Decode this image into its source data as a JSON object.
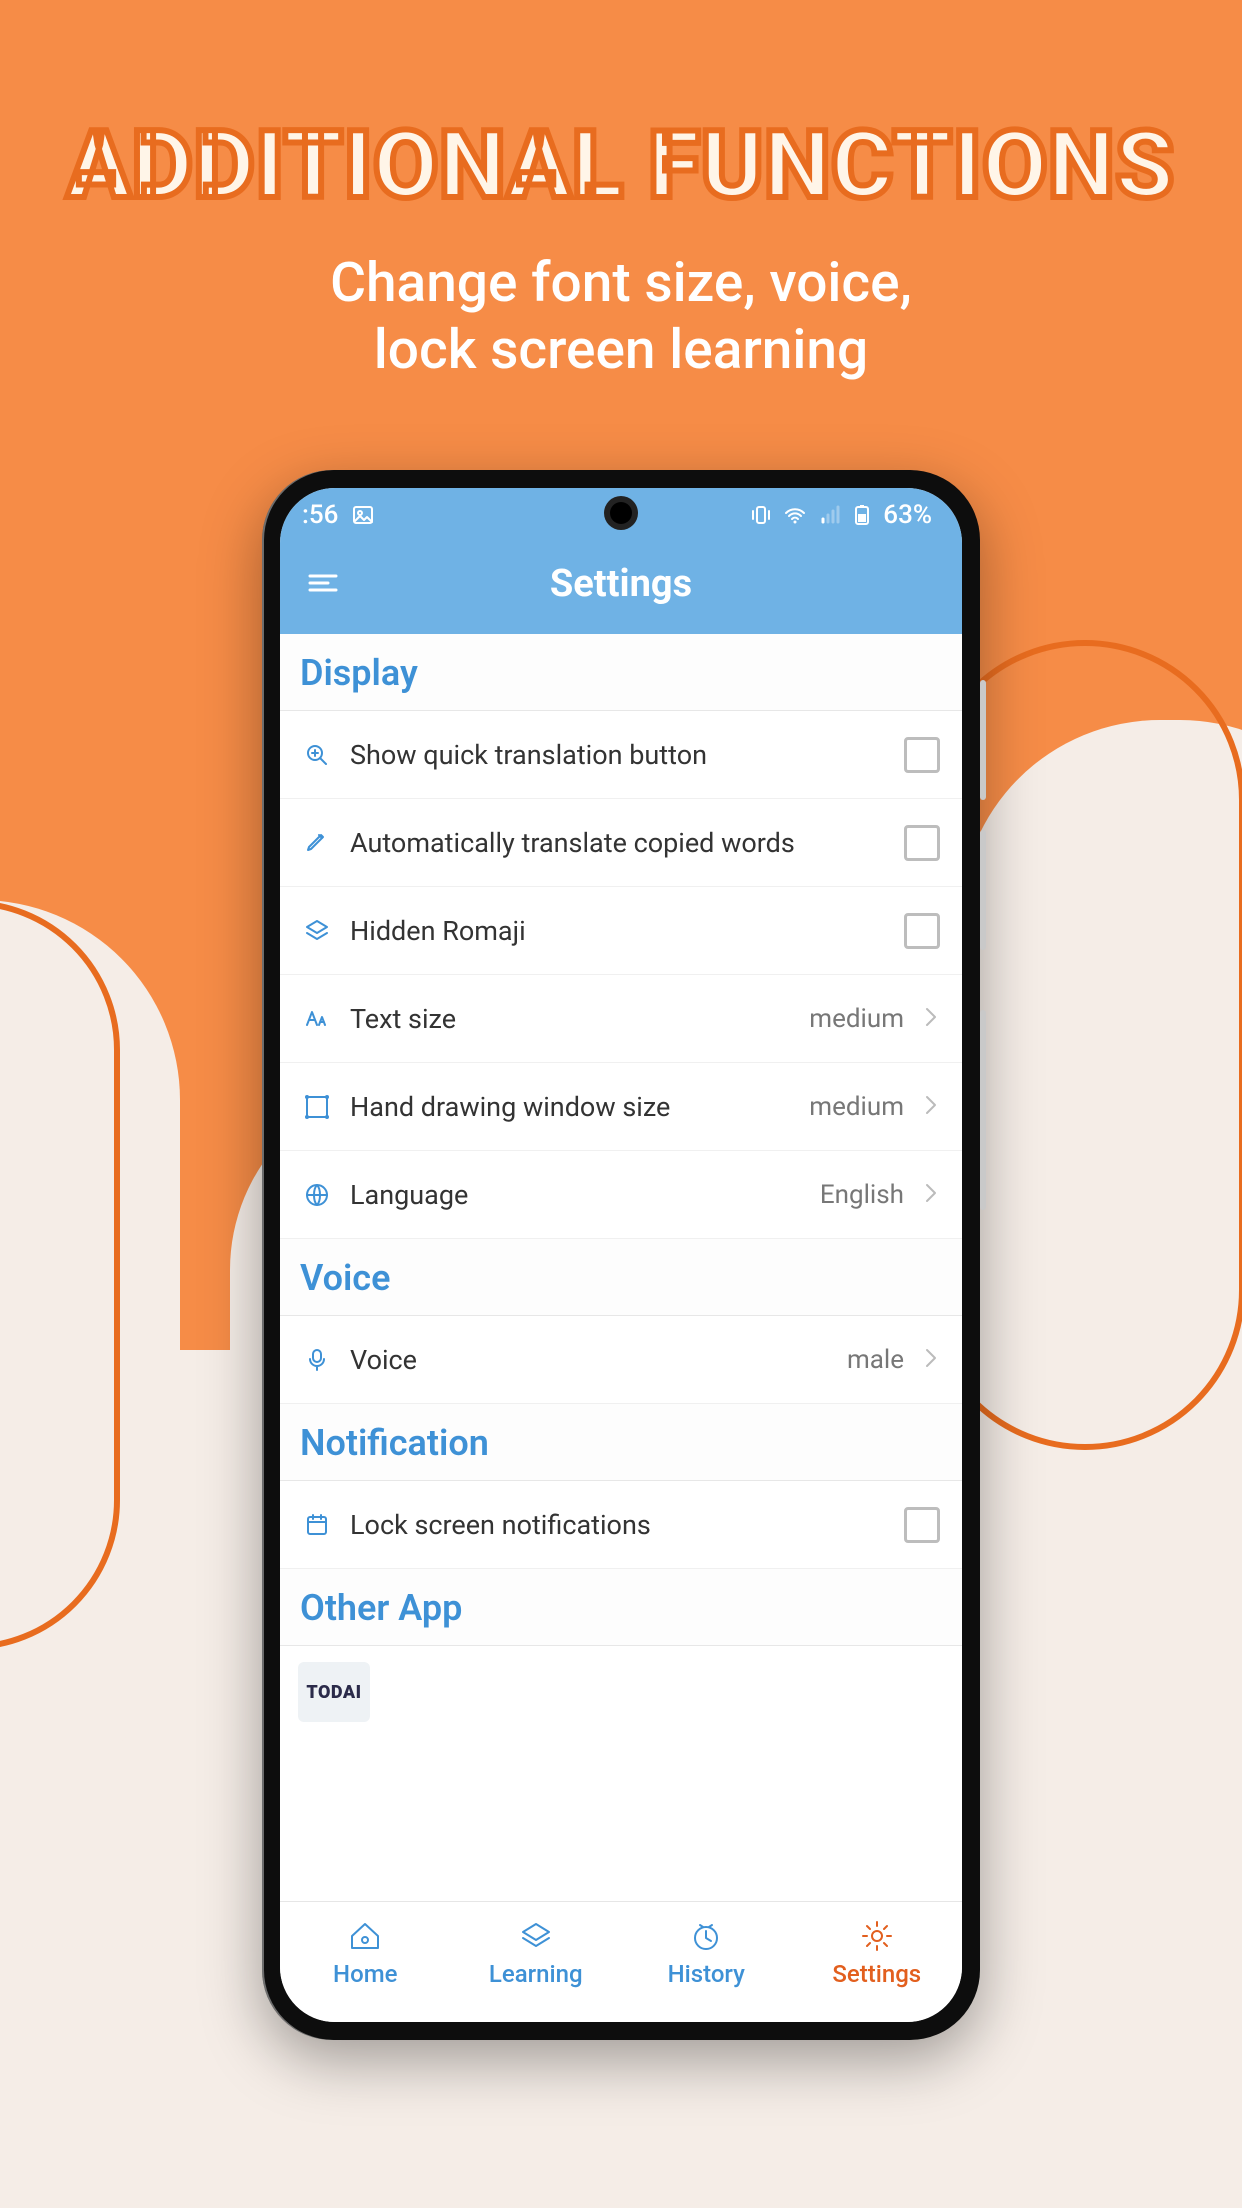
{
  "promo": {
    "title": "ADDITIONAL FUNCTIONS",
    "subtitle_l1": "Change font size, voice,",
    "subtitle_l2": "lock screen learning"
  },
  "status": {
    "time": ":56",
    "battery": "63%"
  },
  "header": {
    "title": "Settings"
  },
  "sections": {
    "display": {
      "title": "Display",
      "items": {
        "quick_translate": "Show quick translation button",
        "auto_translate": "Automatically translate copied words",
        "hidden_romaji": "Hidden Romaji",
        "text_size": {
          "label": "Text size",
          "value": "medium"
        },
        "hand_draw": {
          "label": "Hand drawing window size",
          "value": "medium"
        },
        "language": {
          "label": "Language",
          "value": "English"
        }
      }
    },
    "voice": {
      "title": "Voice",
      "items": {
        "voice": {
          "label": "Voice",
          "value": "male"
        }
      }
    },
    "notification": {
      "title": "Notification",
      "items": {
        "lock_screen": "Lock screen notifications"
      }
    },
    "other": {
      "title": "Other App",
      "thumb_label": "TODAI"
    }
  },
  "nav": {
    "home": "Home",
    "learning": "Learning",
    "history": "History",
    "settings": "Settings"
  }
}
